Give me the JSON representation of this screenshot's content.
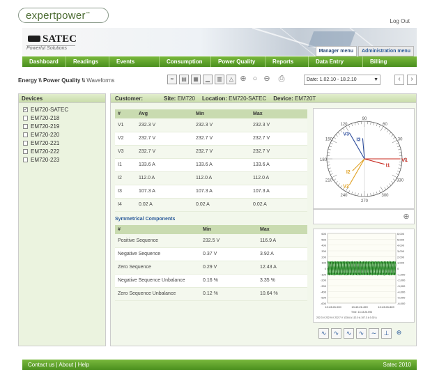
{
  "brand": {
    "name": "expertpower",
    "tm": "™",
    "company": "SATEC",
    "tagline": "Powerful Solutions"
  },
  "header": {
    "logout": "Log Out",
    "tabs": [
      "Manager menu",
      "Administration menu"
    ]
  },
  "nav": [
    "Dashboard",
    "Readings",
    "Events",
    "Consumption",
    "Power Quality",
    "Reports",
    "Data Entry",
    "Billing"
  ],
  "breadcrumb": {
    "bold": "Energy \\\\ Power Quality \\\\",
    "light": "Waveforms"
  },
  "date": {
    "value": "Date: 1.02.10 - 18.2.10"
  },
  "devices": {
    "title": "Devices",
    "items": [
      {
        "label": "EM720-SATEC",
        "checked": true
      },
      {
        "label": "EM720-218",
        "checked": false
      },
      {
        "label": "EM720-219",
        "checked": false
      },
      {
        "label": "EM720-220",
        "checked": false
      },
      {
        "label": "EM720-221",
        "checked": false
      },
      {
        "label": "EM720-222",
        "checked": false
      },
      {
        "label": "EM720-223",
        "checked": false
      }
    ]
  },
  "info": {
    "customer_label": "Customer:",
    "site_label": "Site:",
    "site": "EM720",
    "location_label": "Location:",
    "location": "EM720-SATEC",
    "device_label": "Device:",
    "device": "EM720T"
  },
  "readings": {
    "headers": [
      "#",
      "Avg",
      "Min",
      "Max"
    ],
    "rows": [
      [
        "V1",
        "232.3 V",
        "232.3 V",
        "232.3 V"
      ],
      [
        "V2",
        "232.7 V",
        "232.7 V",
        "232.7 V"
      ],
      [
        "V3",
        "232.7 V",
        "232.7 V",
        "232.7 V"
      ],
      [
        "I1",
        "133.6 A",
        "133.6 A",
        "133.6 A"
      ],
      [
        "I2",
        "112.0 A",
        "112.0 A",
        "112.0 A"
      ],
      [
        "I3",
        "107.3 A",
        "107.3 A",
        "107.3 A"
      ],
      [
        "I4",
        "0.02 A",
        "0.02 A",
        "0.02 A"
      ]
    ]
  },
  "symmetrical": {
    "title": "Symmetrical Components",
    "headers": [
      "#",
      "Avg",
      "Min",
      "Max"
    ],
    "rows": [
      [
        "Positive Sequence",
        "",
        "232.5 V",
        "116.9 A"
      ],
      [
        "Negative Sequence",
        "",
        "0.37 V",
        "3.92 A"
      ],
      [
        "Zero Sequence",
        "",
        "0.29 V",
        "12.43 A"
      ],
      [
        "Negative Sequence Unbalance",
        "",
        "0.16 %",
        "3.35 %"
      ],
      [
        "Zero Sequence Unbalance",
        "",
        "0.12 %",
        "10.64 %"
      ]
    ]
  },
  "phasor": {
    "angle_labels": [
      "90",
      "60",
      "30",
      "0",
      "330",
      "300",
      "270",
      "240",
      "210",
      "180",
      "150",
      "120"
    ],
    "vectors": [
      {
        "label": "V3",
        "angle": 120,
        "mag": 0.8,
        "color": "#2a4a9a"
      },
      {
        "label": "I3",
        "angle": 95,
        "mag": 0.55,
        "color": "#2a4a9a"
      },
      {
        "label": "V1",
        "angle": 0,
        "mag": 0.95,
        "color": "#c8281e"
      },
      {
        "label": "I1",
        "angle": 345,
        "mag": 0.55,
        "color": "#c8281e"
      },
      {
        "label": "V2",
        "angle": 240,
        "mag": 0.8,
        "color": "#e0a020"
      },
      {
        "label": "I2",
        "angle": 225,
        "mag": 0.45,
        "color": "#e0a020"
      }
    ]
  },
  "waveform": {
    "y_ticks": [
      "600",
      "500",
      "400",
      "300",
      "200",
      "100",
      "0",
      "-100",
      "-200",
      "-300",
      "-400",
      "-500",
      "-600"
    ],
    "y2_ticks": [
      "6,000",
      "5,000",
      "4,000",
      "3,000",
      "2,000",
      "1,000",
      "0",
      "-1,000",
      "-2,000",
      "-3,000",
      "-4,000",
      "-5,000",
      "-6,000"
    ],
    "x_ticks": [
      "13:43:26.000",
      "13:43:26.459",
      "13:43:26.869"
    ],
    "time_label": "Time: 13:43:26.593",
    "readout": "232.3 V   232.9 V   232.7 V   133.6 A   112.0 A   107.3 A   0.02 A"
  },
  "footer": {
    "links": "Contact us  |  About  |  Help",
    "copy": "Satec 2010"
  }
}
